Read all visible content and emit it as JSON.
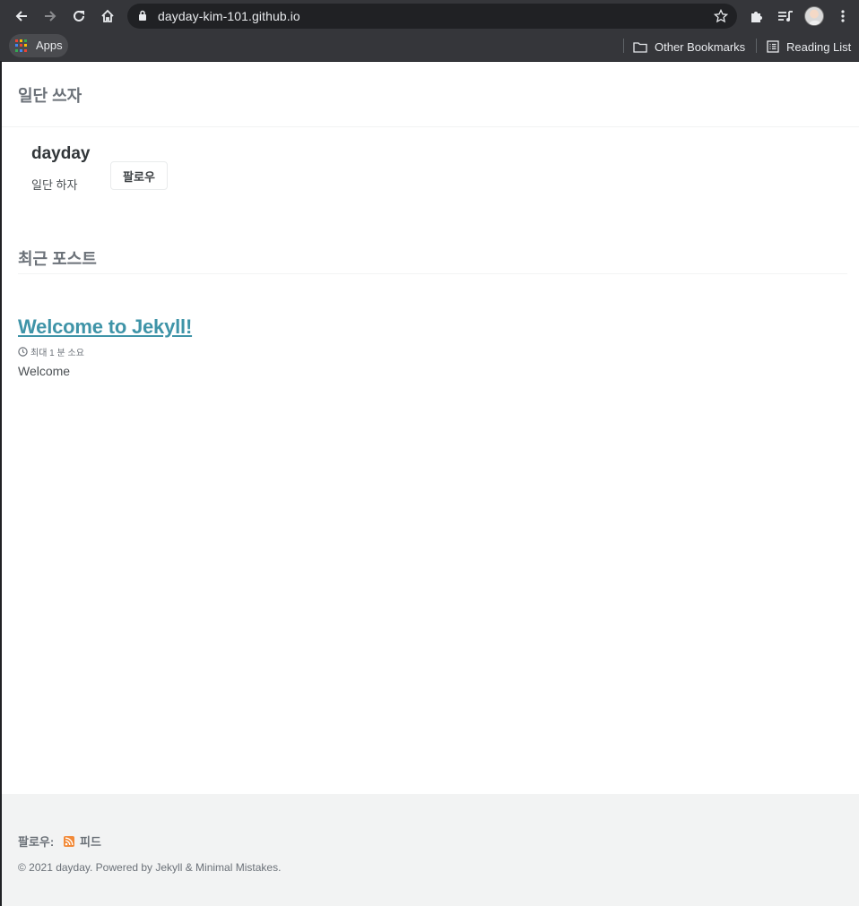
{
  "browser": {
    "url": "dayday-kim-101.github.io",
    "bookmarks": {
      "apps_label": "Apps",
      "other_bookmarks_label": "Other Bookmarks",
      "reading_list_label": "Reading List"
    }
  },
  "site": {
    "title": "일단 쓰자"
  },
  "author": {
    "name": "dayday",
    "bio": "일단 하자",
    "follow_label": "팔로우"
  },
  "recent": {
    "heading": "최근 포스트",
    "posts": [
      {
        "title": "Welcome to Jekyll!",
        "read_time": "최대 1 분 소요",
        "excerpt": "Welcome"
      }
    ]
  },
  "footer": {
    "follow_label": "팔로우:",
    "feed_label": "피드",
    "copyright": "© 2021 dayday. Powered by Jekyll & Minimal Mistakes."
  },
  "colors": {
    "link": "#3f94a8",
    "feed_icon": "#f28a38",
    "chrome_bg": "#35363a"
  }
}
